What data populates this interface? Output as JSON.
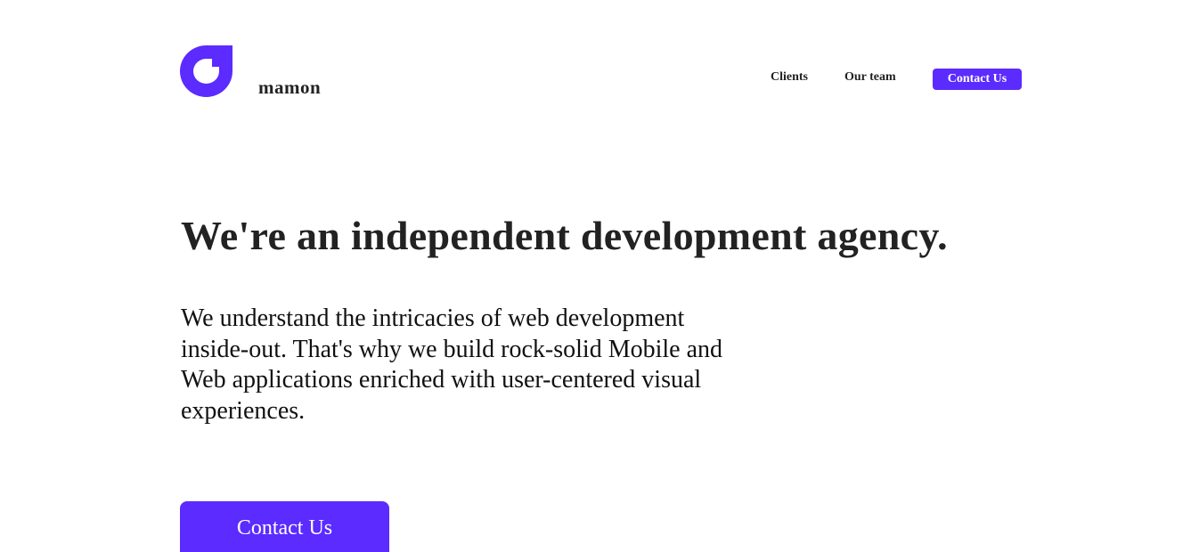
{
  "brand": {
    "name": "mamon",
    "accent_color": "#5b2bff",
    "logo_icon": "brand-logo-icon"
  },
  "nav": {
    "clients_label": "Clients",
    "team_label": "Our team",
    "contact_label": "Contact Us"
  },
  "hero": {
    "title": "We're an independent development agency.",
    "description": "We understand the intricacies of web development inside-out. That's why we build rock-solid Mobile and Web applications enriched with user-centered visual experiences.",
    "cta_label": "Contact Us"
  }
}
